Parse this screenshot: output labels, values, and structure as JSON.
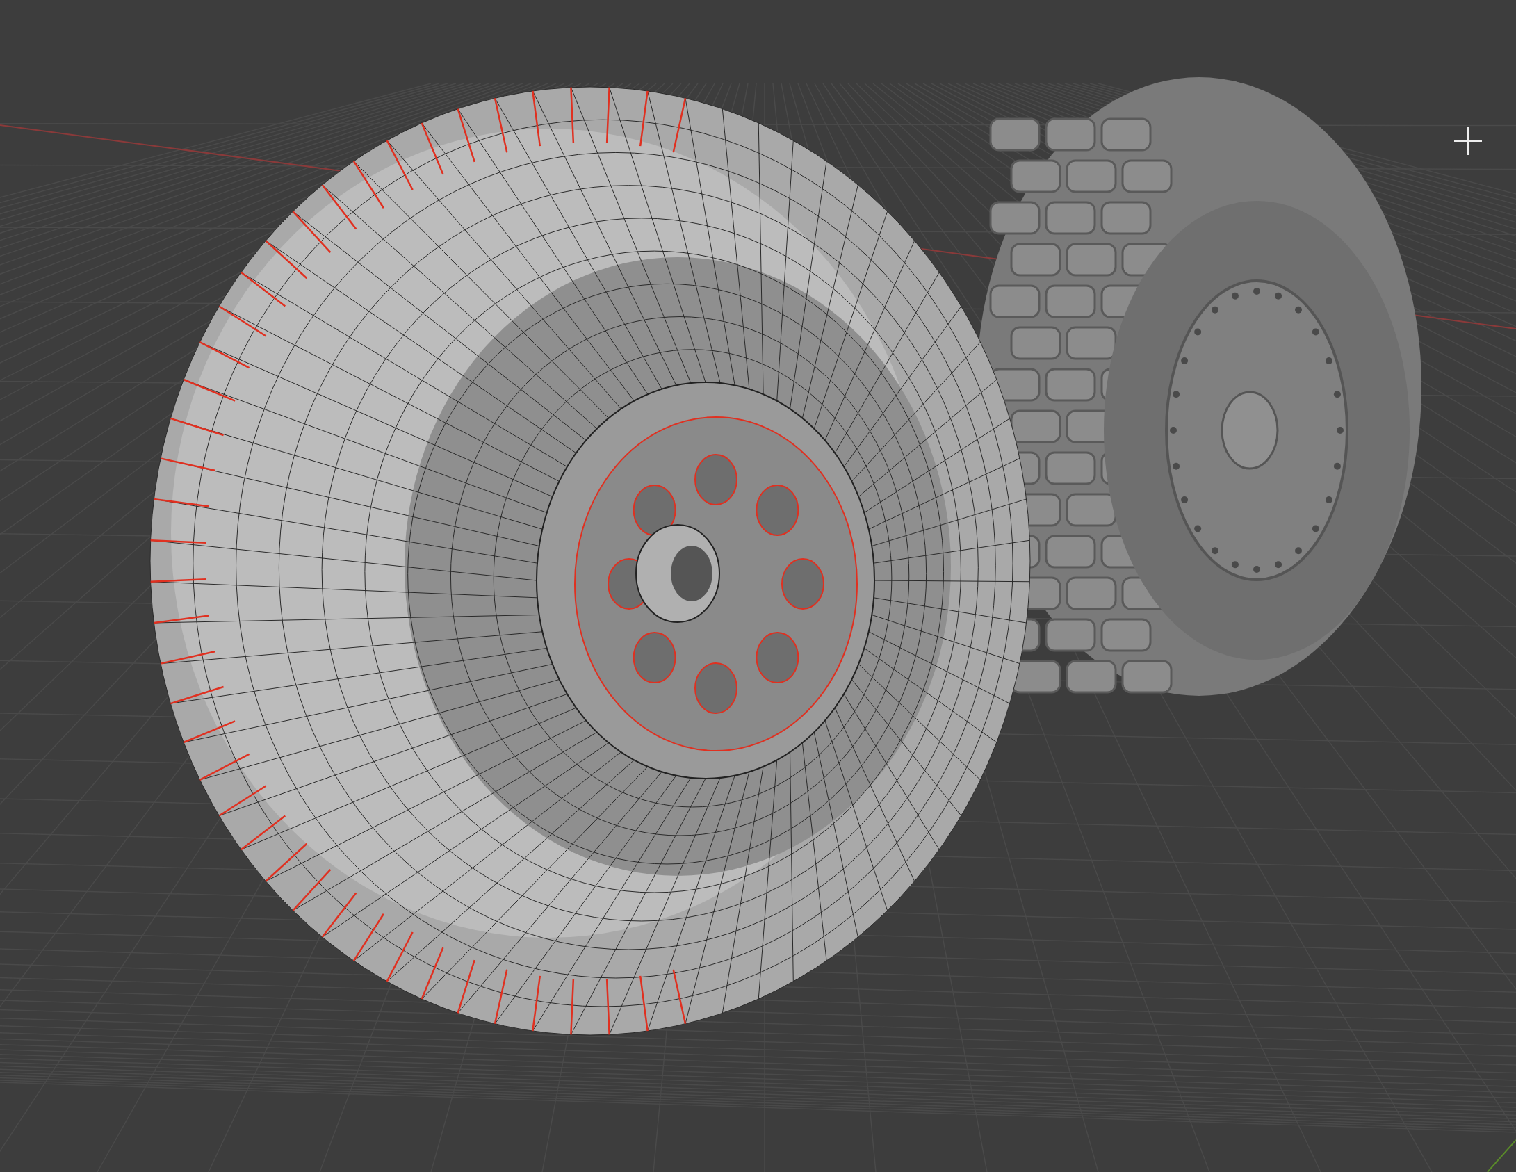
{
  "viewport": {
    "objects": [
      {
        "kind": "tread-tire"
      },
      {
        "kind": "wireframe-tire"
      }
    ]
  }
}
